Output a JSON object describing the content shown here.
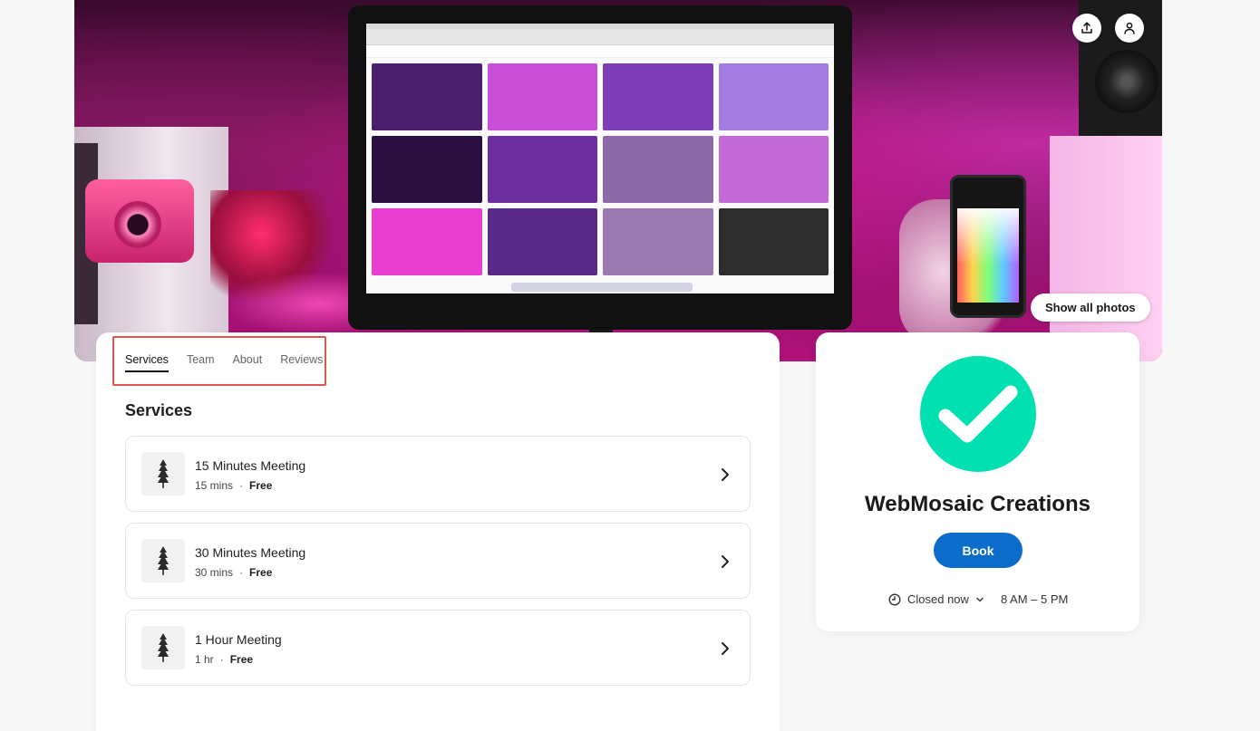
{
  "hero": {
    "show_photos_label": "Show all photos",
    "share_icon": "share-icon",
    "user_icon": "user-icon"
  },
  "tabs": [
    {
      "label": "Services",
      "active": true
    },
    {
      "label": "Team",
      "active": false
    },
    {
      "label": "About",
      "active": false
    },
    {
      "label": "Reviews",
      "active": false
    }
  ],
  "services_section": {
    "title": "Services",
    "items": [
      {
        "name": "15 Minutes Meeting",
        "duration": "15 mins",
        "separator": "·",
        "price": "Free"
      },
      {
        "name": "30 Minutes Meeting",
        "duration": "30 mins",
        "separator": "·",
        "price": "Free"
      },
      {
        "name": "1 Hour Meeting",
        "duration": "1 hr",
        "separator": "·",
        "price": "Free"
      }
    ]
  },
  "business": {
    "name": "WebMosaic Creations",
    "book_label": "Book",
    "status": "Closed now",
    "hours": "8 AM – 5 PM"
  },
  "colors": {
    "accent": "#0b6dc9",
    "logo": "#00e0b0",
    "highlight": "#e0564f"
  }
}
